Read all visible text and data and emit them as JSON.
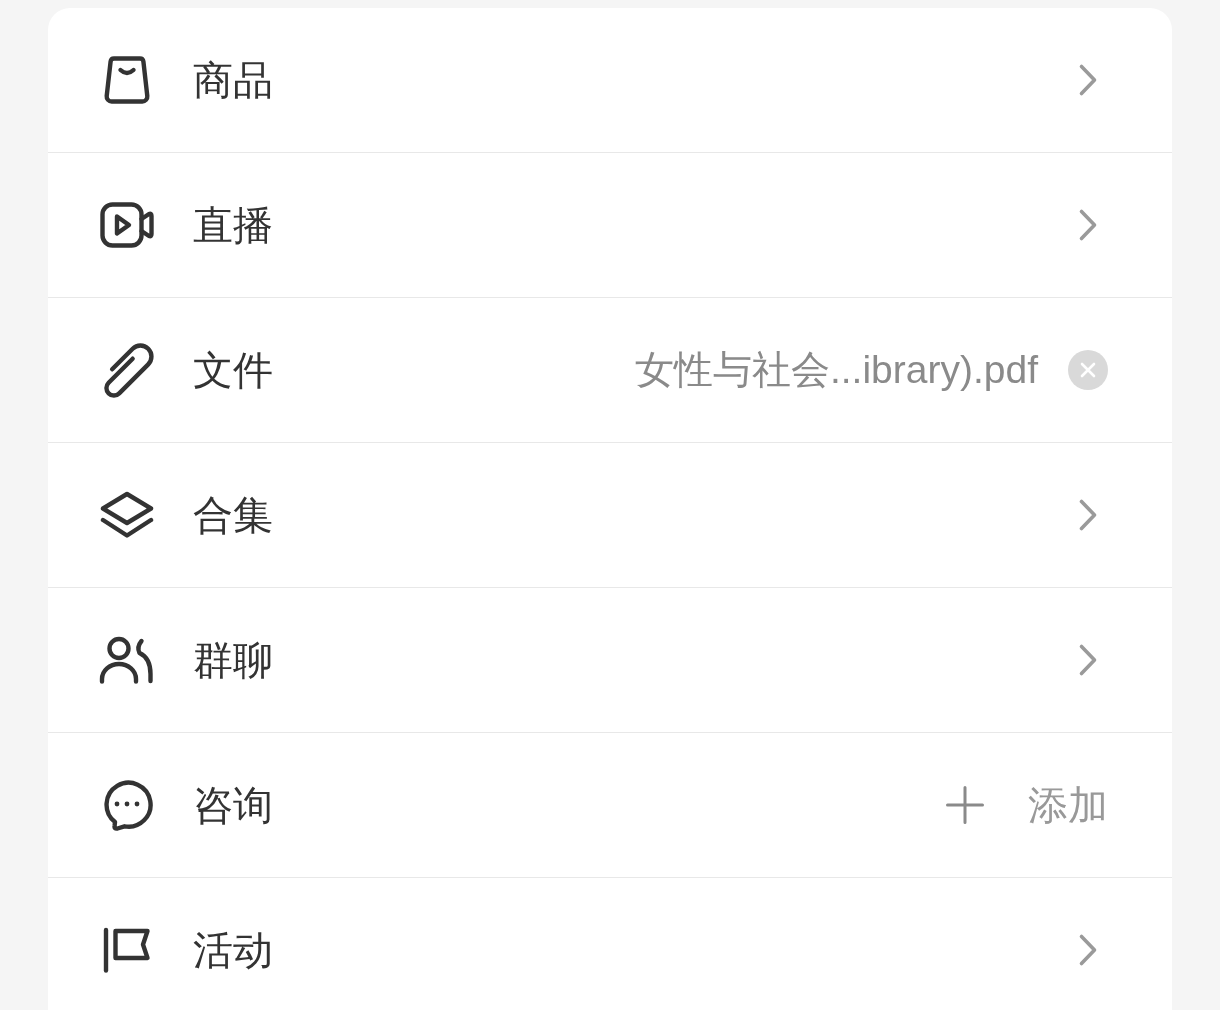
{
  "rows": [
    {
      "kind": "link",
      "label": "商品"
    },
    {
      "kind": "link",
      "label": "直播"
    },
    {
      "kind": "file",
      "label": "文件",
      "value": "女性与社会...ibrary).pdf"
    },
    {
      "kind": "link",
      "label": "合集"
    },
    {
      "kind": "link",
      "label": "群聊"
    },
    {
      "kind": "add",
      "label": "咨询",
      "action": "添加"
    },
    {
      "kind": "link",
      "label": "活动"
    }
  ]
}
